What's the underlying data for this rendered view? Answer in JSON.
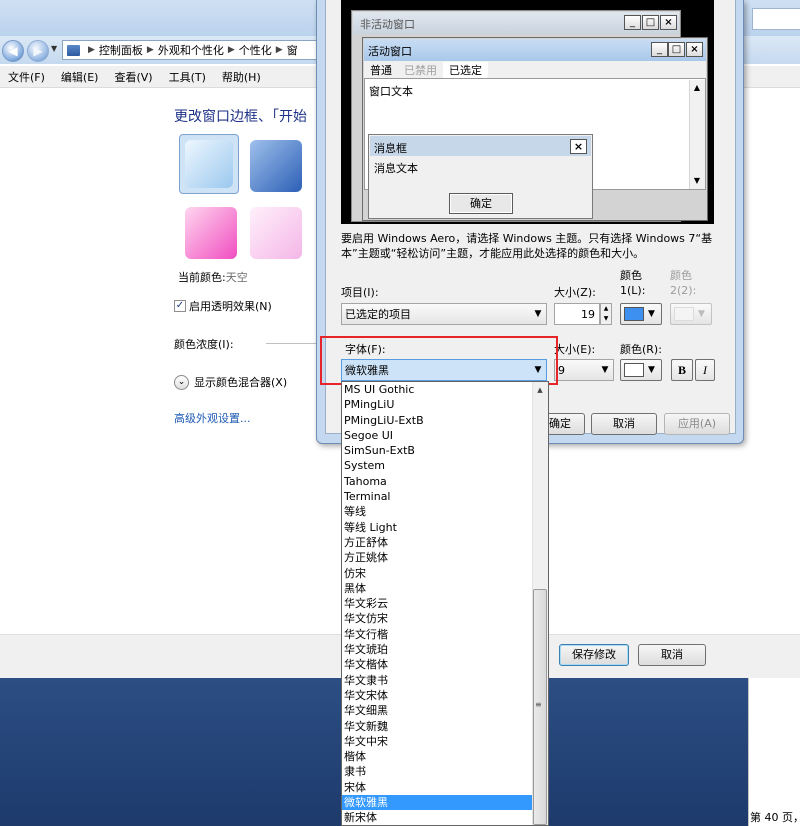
{
  "explorer": {
    "breadcrumb": [
      "控制面板",
      "外观和个性化",
      "个性化",
      "窗"
    ],
    "menu": [
      "文件(F)",
      "编辑(E)",
      "查看(V)",
      "工具(T)",
      "帮助(H)"
    ],
    "title": "更改窗口边框、「开始",
    "current_color_label": "当前颜色:",
    "current_color_value": "天空",
    "transparency_label": "启用透明效果(N)",
    "intensity_label": "颜色浓度(I):",
    "mixer_label": "显示颜色混合器(X)",
    "advanced_link": "高级外观设置...",
    "save_button": "保存修改",
    "cancel_button": "取消",
    "page_status": "第 40 页，"
  },
  "preview": {
    "inactive_title": "非活动窗口",
    "active_title": "活动窗口",
    "menu": [
      {
        "label": "普通",
        "state": "normal"
      },
      {
        "label": "已禁用",
        "state": "disabled"
      },
      {
        "label": "已选定",
        "state": "selected"
      }
    ],
    "window_text": "窗口文本",
    "msgbox_title": "消息框",
    "msgbox_text": "消息文本",
    "ok_button": "确定",
    "min_glyph": "_",
    "max_glyph": "□",
    "close_glyph": "×"
  },
  "dialog": {
    "hint": "要启用 Windows Aero，请选择 Windows 主题。只有选择 Windows 7“基本”主题或“轻松访问”主题，才能应用此处选择的颜色和大小。",
    "item_label": "项目(I):",
    "item_value": "已选定的项目",
    "size_label": "大小(Z):",
    "size_value": "19",
    "color1_label": "颜色\n1(L):",
    "color1_value": "#3d8ff0",
    "color2_label": "颜色\n2(2):",
    "font_label": "字体(F):",
    "font_value": "微软雅黑",
    "font_size_label": "大小(E):",
    "font_size_value": "9",
    "font_color_label": "颜色(R):",
    "bold_label": "B",
    "italic_label": "I",
    "ok_button": "确定",
    "cancel_button": "取消",
    "apply_button": "应用(A)"
  },
  "font_list": {
    "items": [
      "MS UI Gothic",
      "PMingLiU",
      "PMingLiU-ExtB",
      "Segoe UI",
      "SimSun-ExtB",
      "System",
      "Tahoma",
      "Terminal",
      "等线",
      "等线 Light",
      "方正舒体",
      "方正姚体",
      "仿宋",
      "黑体",
      "华文彩云",
      "华文仿宋",
      "华文行楷",
      "华文琥珀",
      "华文楷体",
      "华文隶书",
      "华文宋体",
      "华文细黑",
      "华文新魏",
      "华文中宋",
      "楷体",
      "隶书",
      "宋体",
      "微软雅黑",
      "新宋体"
    ],
    "selected": "微软雅黑"
  }
}
